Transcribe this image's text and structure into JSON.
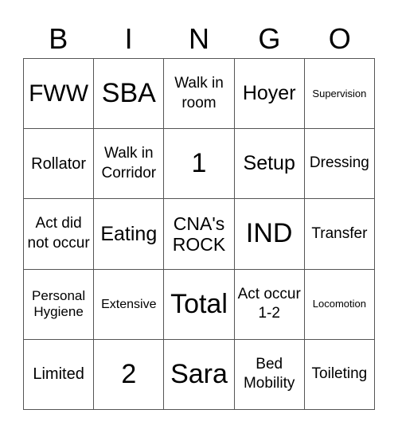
{
  "header": {
    "letters": [
      "B",
      "I",
      "N",
      "G",
      "O"
    ]
  },
  "grid": {
    "rows": [
      [
        "FWW",
        "SBA",
        "Walk in room",
        "Hoyer",
        "Supervision"
      ],
      [
        "Rollator",
        "Walk in Corridor",
        "1",
        "Setup",
        "Dressing"
      ],
      [
        "Act did not occur",
        "Eating",
        "CNA's ROCK",
        "IND",
        "Transfer"
      ],
      [
        "Personal Hygiene",
        "Extensive",
        "Total",
        "Act occur 1-2",
        "Locomotion"
      ],
      [
        "Limited",
        "2",
        "Sara",
        "Bed Mobility",
        "Toileting"
      ]
    ]
  },
  "colors": {
    "background": "#ffffff",
    "text": "#000000",
    "grid_line": "#555555"
  }
}
